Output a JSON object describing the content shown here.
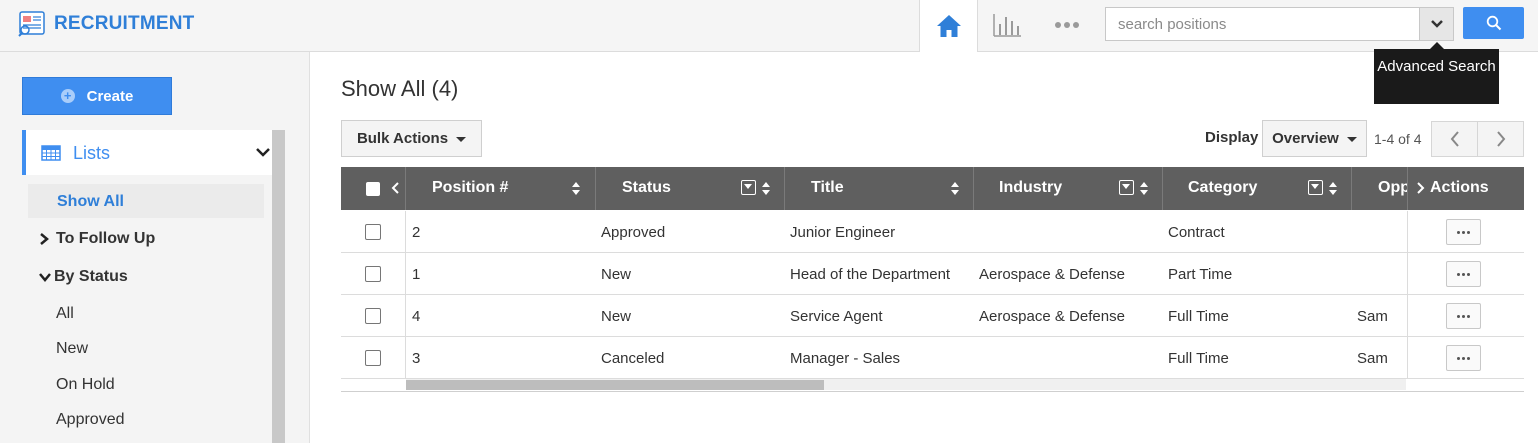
{
  "app": {
    "title": "RECRUITMENT"
  },
  "header": {
    "search": {
      "placeholder": "search positions"
    },
    "tooltip": "Advanced Search"
  },
  "sidebar": {
    "create_label": "Create",
    "lists_label": "Lists",
    "show_all": "Show All",
    "to_follow_up": "To Follow Up",
    "by_status": "By Status",
    "status_items": [
      "All",
      "New",
      "On Hold",
      "Approved"
    ]
  },
  "main": {
    "title": "Show All (4)",
    "bulk_actions": "Bulk Actions",
    "display_label": "Display",
    "display_value": "Overview",
    "pager_text": "1-4 of 4"
  },
  "table": {
    "columns": [
      "Position #",
      "Status",
      "Title",
      "Industry",
      "Category",
      "Opp",
      "Actions"
    ],
    "rows": [
      {
        "position": "2",
        "status": "Approved",
        "title": "Junior Engineer",
        "industry": "",
        "category": "Contract",
        "opp": ""
      },
      {
        "position": "1",
        "status": "New",
        "title": "Head of the Department",
        "industry": "Aerospace & Defense",
        "category": "Part Time",
        "opp": ""
      },
      {
        "position": "4",
        "status": "New",
        "title": "Service Agent",
        "industry": "Aerospace & Defense",
        "category": "Full Time",
        "opp": "Sam"
      },
      {
        "position": "3",
        "status": "Canceled",
        "title": "Manager - Sales",
        "industry": "",
        "category": "Full Time",
        "opp": "Sam"
      }
    ]
  },
  "colors": {
    "accent": "#3f8ef0",
    "brand": "#2f7fd8",
    "table_header": "#5f5f5f"
  },
  "icons": [
    "logo-icon",
    "home-icon",
    "bar-chart-icon",
    "more-icon",
    "chevron-down-icon",
    "search-icon",
    "plus-circle-icon",
    "calendar-grid-icon",
    "chevron-right-icon",
    "chevron-left-icon",
    "sort-icon",
    "filter-icon"
  ]
}
